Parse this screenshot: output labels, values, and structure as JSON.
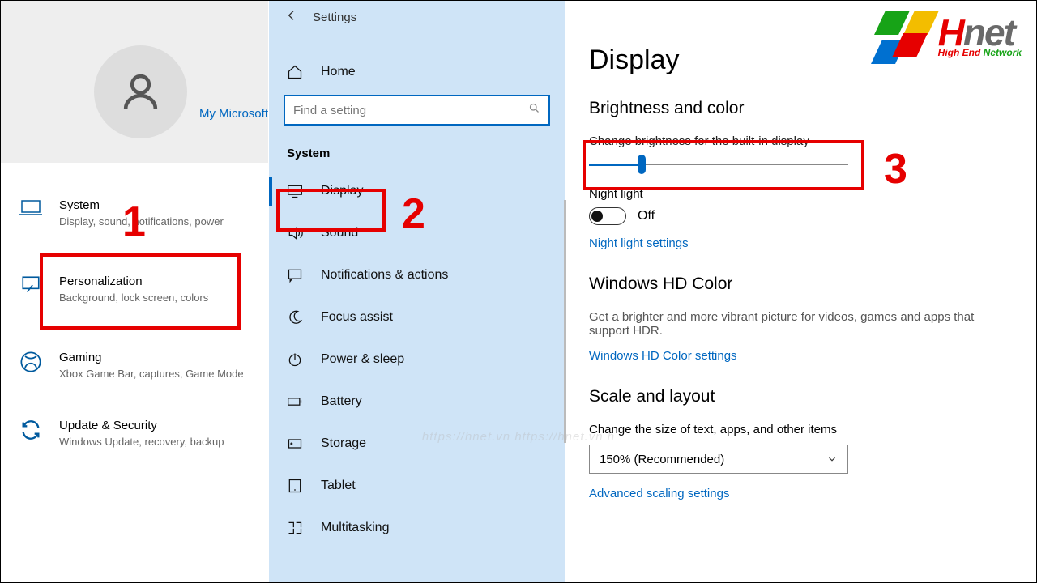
{
  "left": {
    "ms_link": "My Microsoft",
    "tiles": [
      {
        "title": "System",
        "sub": "Display, sound, notifications, power"
      },
      {
        "title": "Personalization",
        "sub": "Background, lock screen, colors"
      },
      {
        "title": "Gaming",
        "sub": "Xbox Game Bar, captures, Game Mode"
      },
      {
        "title": "Update & Security",
        "sub": "Windows Update, recovery, backup"
      }
    ]
  },
  "mid": {
    "header_title": "Settings",
    "home": "Home",
    "search_placeholder": "Find a setting",
    "section": "System",
    "items": [
      "Display",
      "Sound",
      "Notifications & actions",
      "Focus assist",
      "Power & sleep",
      "Battery",
      "Storage",
      "Tablet",
      "Multitasking"
    ]
  },
  "right": {
    "title": "Display",
    "brightness_section": "Brightness and color",
    "slider_label": "Change brightness for the built-in display",
    "night_light": "Night light",
    "toggle_state": "Off",
    "night_light_link": "Night light settings",
    "hd_section": "Windows HD Color",
    "hd_desc": "Get a brighter and more vibrant picture for videos, games and apps that support HDR.",
    "hd_link": "Windows HD Color settings",
    "scale_section": "Scale and layout",
    "scale_label": "Change the size of text, apps, and other items",
    "scale_value": "150% (Recommended)",
    "adv_link": "Advanced scaling settings"
  },
  "annotations": {
    "one": "1",
    "two": "2",
    "three": "3"
  },
  "logo": {
    "brand_h": "H",
    "brand_rest": "net",
    "tag_he": "High End ",
    "tag_nw": "Network"
  },
  "watermark": "https://hnet.vn    https://hnet.vn    h"
}
